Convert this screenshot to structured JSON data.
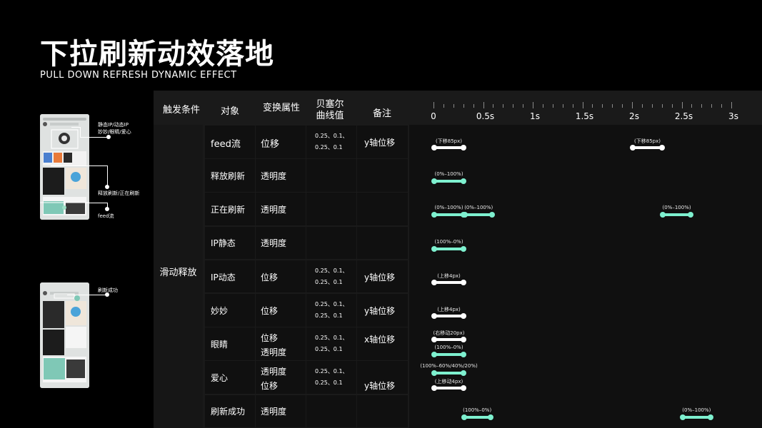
{
  "header": {
    "title": "下拉刷新动效落地",
    "subtitle": "PULL DOWN REFRESH DYNAMIC EFFECT"
  },
  "annotations": {
    "a1_line1": "静态IP/动态IP",
    "a1_line2": "妙妙/眼睛/爱心",
    "a2": "释放刷新/正在刷新",
    "a3": "feed流",
    "a4": "刷新成功"
  },
  "table": {
    "headers": {
      "trigger": "触发条件",
      "object": "对象",
      "property": "变换属性",
      "bezier_line1": "贝塞尔",
      "bezier_line2": "曲线值",
      "note": "备注"
    },
    "trigger": "滑动释放",
    "rows": [
      {
        "object": "feed流",
        "props": [
          "位移"
        ],
        "bezier": [
          "0.25、0.1、",
          "0.25、0.1"
        ],
        "note": "y轴位移"
      },
      {
        "object": "释放刷新",
        "props": [
          "透明度"
        ],
        "bezier": [],
        "note": ""
      },
      {
        "object": "正在刷新",
        "props": [
          "透明度"
        ],
        "bezier": [],
        "note": ""
      },
      {
        "object": "IP静态",
        "props": [
          "透明度"
        ],
        "bezier": [],
        "note": ""
      },
      {
        "object": "IP动态",
        "props": [
          "位移"
        ],
        "bezier": [
          "0.25、0.1、",
          "0.25、0.1"
        ],
        "note": "y轴位移"
      },
      {
        "object": "妙妙",
        "props": [
          "位移"
        ],
        "bezier": [
          "0.25、0.1、",
          "0.25、0.1"
        ],
        "note": "y轴位移"
      },
      {
        "object": "眼睛",
        "props": [
          "位移",
          "透明度"
        ],
        "bezier": [
          "0.25、0.1、",
          "0.25、0.1"
        ],
        "note": "x轴位移"
      },
      {
        "object": "爱心",
        "props": [
          "透明度",
          "位移"
        ],
        "bezier": [
          "0.25、0.1、",
          "0.25、0.1"
        ],
        "note": "y轴位移"
      },
      {
        "object": "刷新成功",
        "props": [
          "透明度"
        ],
        "bezier": [],
        "note": ""
      }
    ]
  },
  "timeline": {
    "axis_labels": [
      "0",
      "0.5s",
      "1s",
      "1.5s",
      "2s",
      "2.5s",
      "3s"
    ],
    "axis_values": [
      0,
      0.5,
      1,
      1.5,
      2,
      2.5,
      3
    ],
    "colors": {
      "position": "#ffffff",
      "opacity": "#7ef0cf"
    },
    "bars": [
      {
        "row": 0,
        "start": 0.0,
        "end": 0.31,
        "kind": "position",
        "label": "(下移85px)"
      },
      {
        "row": 0,
        "start": 2.0,
        "end": 2.31,
        "kind": "position",
        "label": "(下移85px)"
      },
      {
        "row": 1,
        "start": 0.0,
        "end": 0.31,
        "kind": "opacity",
        "label": "(0%–100%)"
      },
      {
        "row": 2,
        "start": 0.0,
        "end": 0.31,
        "kind": "opacity",
        "label": "(0%–100%)"
      },
      {
        "row": 2,
        "start": 0.31,
        "end": 0.6,
        "kind": "opacity",
        "label": "(0%–100%)"
      },
      {
        "row": 2,
        "start": 2.3,
        "end": 2.6,
        "kind": "opacity",
        "label": "(0%–100%)"
      },
      {
        "row": 3,
        "start": 0.0,
        "end": 0.31,
        "kind": "opacity",
        "label": "(100%–0%)"
      },
      {
        "row": 4,
        "start": 0.0,
        "end": 0.31,
        "kind": "position",
        "label": "(上移4px)"
      },
      {
        "row": 5,
        "start": 0.0,
        "end": 0.31,
        "kind": "position",
        "label": "(上移4px)"
      },
      {
        "row": 6,
        "start": 0.0,
        "end": 0.31,
        "kind": "position",
        "label": "(右移动20px)",
        "sub": 0
      },
      {
        "row": 6,
        "start": 0.0,
        "end": 0.31,
        "kind": "opacity",
        "label": "(100%–0%)",
        "sub": 1
      },
      {
        "row": 7,
        "start": 0.0,
        "end": 0.31,
        "kind": "opacity",
        "label": "(100%–60%/40%/20%)",
        "sub": 0
      },
      {
        "row": 7,
        "start": 0.0,
        "end": 0.31,
        "kind": "position",
        "label": "(上移动4px)",
        "sub": 1
      },
      {
        "row": 8,
        "start": 0.3,
        "end": 0.58,
        "kind": "opacity",
        "label": "(100%–0%)"
      },
      {
        "row": 8,
        "start": 2.5,
        "end": 2.8,
        "kind": "opacity",
        "label": "(0%–100%)"
      }
    ]
  }
}
